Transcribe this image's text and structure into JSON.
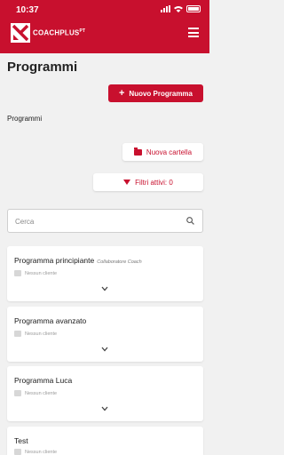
{
  "status": {
    "time": "10:37"
  },
  "header": {
    "logo_text": "COACHPLUS",
    "logo_sup": "PT"
  },
  "page": {
    "title": "Programmi",
    "section_label": "Programmi"
  },
  "actions": {
    "new_program": "Nuovo Programma",
    "new_folder": "Nuova cartella",
    "filters": "Filtri attivi: 0"
  },
  "search": {
    "placeholder": "Cerca",
    "value": ""
  },
  "programs": [
    {
      "title": "Programma principiante",
      "role": "Collaboratore Coach",
      "client": "Nessun cliente"
    },
    {
      "title": "Programma avanzato",
      "role": "",
      "client": "Nessun cliente"
    },
    {
      "title": "Programma Luca",
      "role": "",
      "client": "Nessun cliente"
    },
    {
      "title": "Test",
      "role": "",
      "client": "Nessun cliente"
    }
  ],
  "colors": {
    "brand": "#c8102e",
    "background": "#f1f1f1"
  }
}
